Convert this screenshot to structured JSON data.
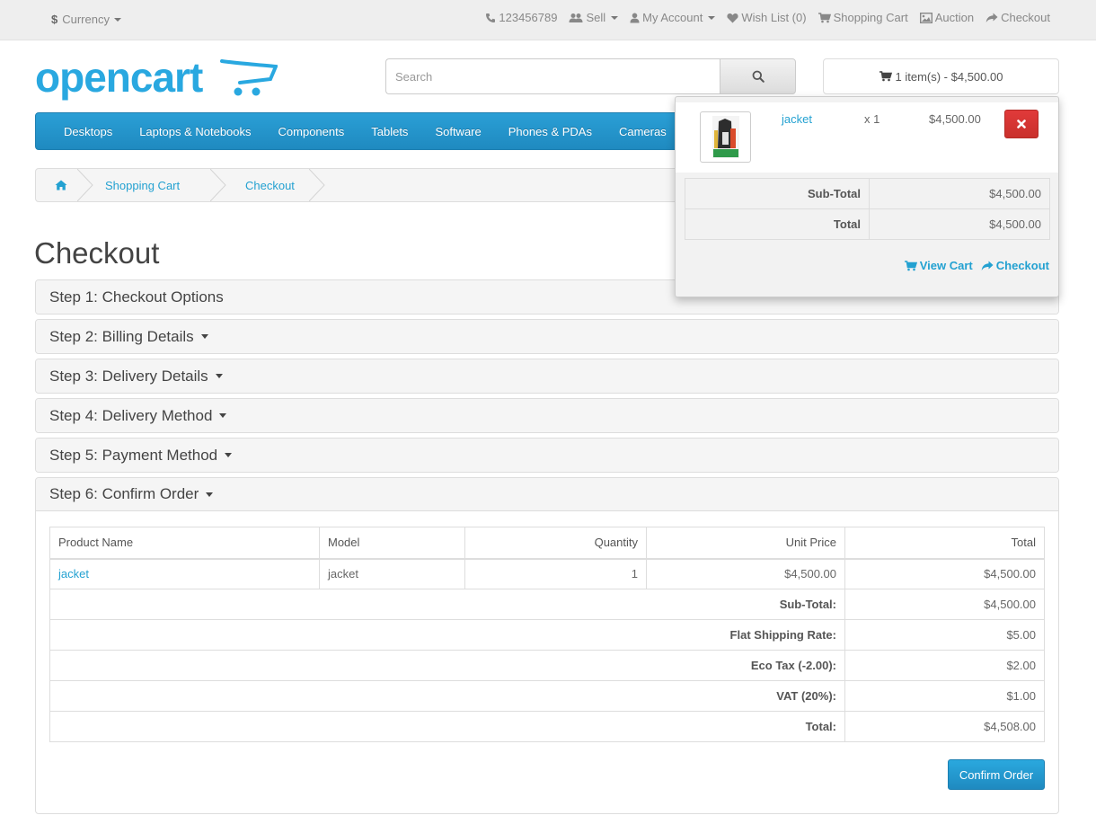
{
  "topbar": {
    "currency": {
      "symbol": "$",
      "label": "Currency"
    },
    "phone": "123456789",
    "sell": "Sell",
    "my_account": "My Account",
    "wish_list": "Wish List (0)",
    "shopping_cart": "Shopping Cart",
    "auction": "Auction",
    "checkout": "Checkout"
  },
  "header": {
    "logo_text": "opencart",
    "search": {
      "placeholder": "Search",
      "value": ""
    },
    "cart_button": "1 item(s) - $4,500.00"
  },
  "nav": {
    "items": [
      "Desktops",
      "Laptops & Notebooks",
      "Components",
      "Tablets",
      "Software",
      "Phones & PDAs",
      "Cameras"
    ]
  },
  "breadcrumb": {
    "items": [
      "Shopping Cart",
      "Checkout"
    ]
  },
  "page_title": "Checkout",
  "steps": [
    "Step 1: Checkout Options",
    "Step 2: Billing Details",
    "Step 3: Delivery Details",
    "Step 4: Delivery Method",
    "Step 5: Payment Method",
    "Step 6: Confirm Order"
  ],
  "order": {
    "headers": {
      "product": "Product Name",
      "model": "Model",
      "quantity": "Quantity",
      "unit_price": "Unit Price",
      "total": "Total"
    },
    "row": {
      "product": "jacket",
      "model": "jacket",
      "quantity": "1",
      "unit_price": "$4,500.00",
      "total": "$4,500.00"
    },
    "totals": [
      {
        "label": "Sub-Total:",
        "value": "$4,500.00"
      },
      {
        "label": "Flat Shipping Rate:",
        "value": "$5.00"
      },
      {
        "label": "Eco Tax (-2.00):",
        "value": "$2.00"
      },
      {
        "label": "VAT (20%):",
        "value": "$1.00"
      },
      {
        "label": "Total:",
        "value": "$4,508.00"
      }
    ],
    "confirm_button": "Confirm Order"
  },
  "cart_dropdown": {
    "item": {
      "name": "jacket",
      "qty": "x 1",
      "price": "$4,500.00"
    },
    "totals": [
      {
        "label": "Sub-Total",
        "value": "$4,500.00"
      },
      {
        "label": "Total",
        "value": "$4,500.00"
      }
    ],
    "view_cart": "View Cart",
    "checkout": "Checkout"
  },
  "colors": {
    "accent": "#23a1d1",
    "nav": "#229ac8",
    "danger": "#da4f49",
    "logo": "#29a8e0"
  }
}
